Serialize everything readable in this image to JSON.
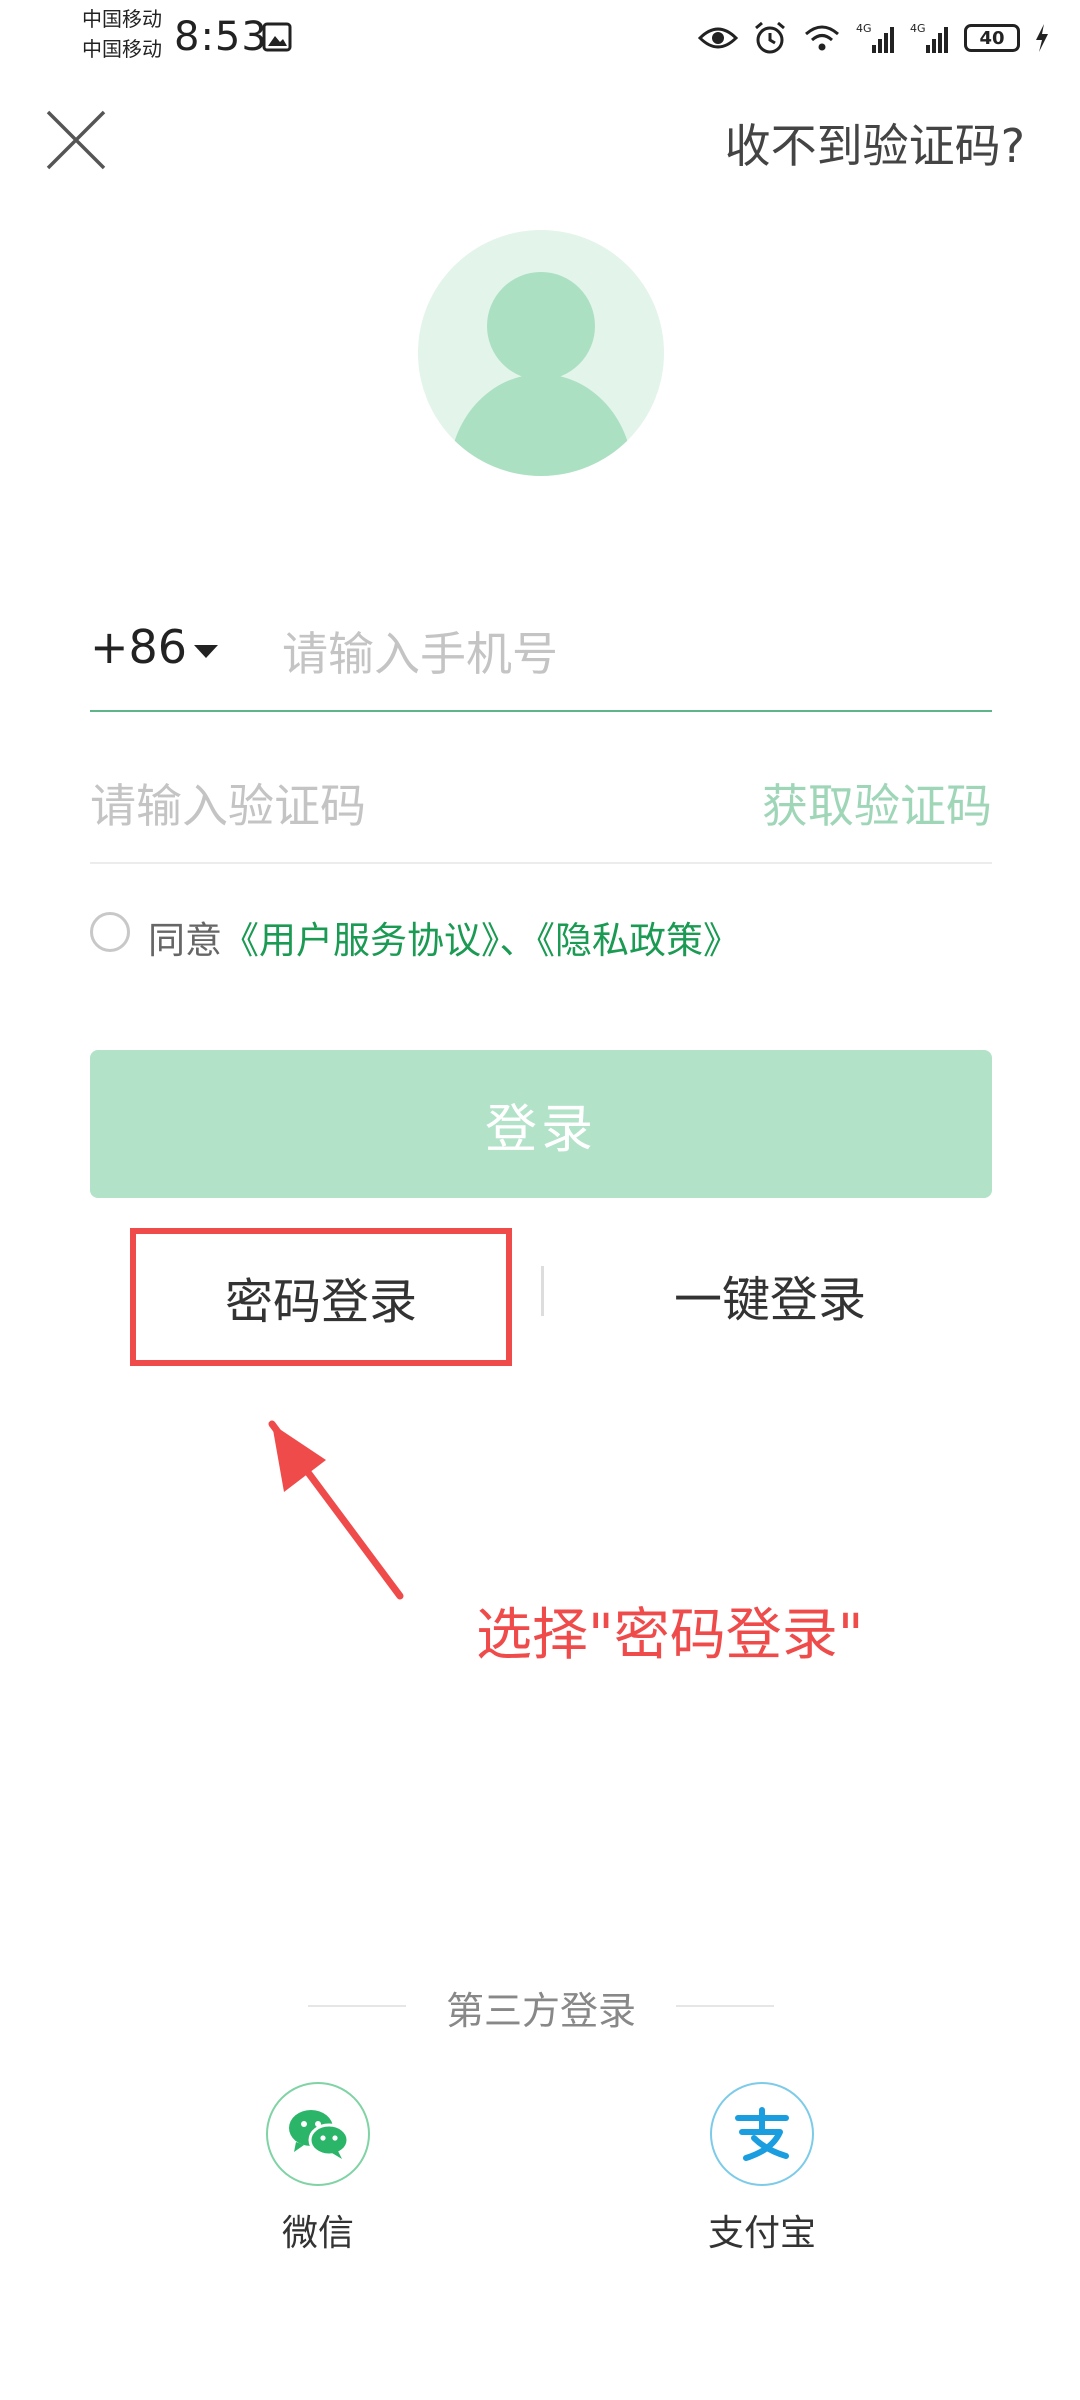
{
  "status_bar": {
    "carrier_1": "中国移动",
    "carrier_2": "中国移动",
    "time": "8:53",
    "battery": "40"
  },
  "header": {
    "help_link": "收不到验证码?"
  },
  "form": {
    "country_code": "+86",
    "phone_placeholder": "请输入手机号",
    "code_placeholder": "请输入验证码",
    "get_code_label": "获取验证码",
    "agree_prefix": "同意",
    "user_agreement": "《用户服务协议》",
    "separator": "、",
    "privacy_policy": "《隐私政策》",
    "login_button": "登录"
  },
  "alt_login": {
    "password_login": "密码登录",
    "one_key_login": "一键登录"
  },
  "annotation": {
    "text": "选择\"密码登录\""
  },
  "third_party": {
    "title": "第三方登录",
    "wechat_label": "微信",
    "alipay_label": "支付宝"
  },
  "colors": {
    "brand_green": "#1a9a52",
    "button_disabled": "#b2e2c8",
    "annotation_red": "#ef4b4b"
  },
  "icons": [
    "close-icon",
    "avatar-placeholder-icon",
    "wechat-icon",
    "alipay-icon",
    "annotation-arrow-icon"
  ]
}
